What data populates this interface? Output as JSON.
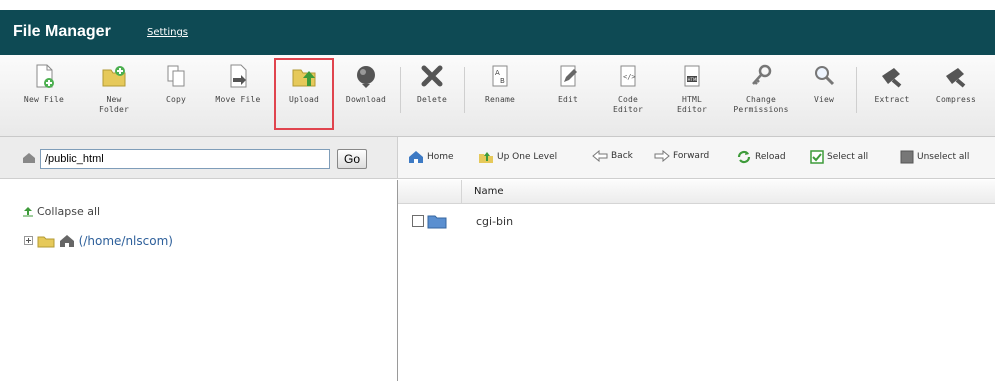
{
  "header": {
    "title": "File Manager",
    "settings_link": "Settings"
  },
  "toolbar": {
    "tools": [
      {
        "id": "new-file",
        "label": "New File",
        "icon": "new-file-icon"
      },
      {
        "id": "new-folder",
        "label": "New\nFolder",
        "icon": "new-folder-icon"
      },
      {
        "id": "copy",
        "label": "Copy",
        "icon": "copy-icon"
      },
      {
        "id": "move-file",
        "label": "Move File",
        "icon": "move-file-icon"
      },
      {
        "id": "upload",
        "label": "Upload",
        "icon": "upload-icon",
        "highlighted": true
      },
      {
        "id": "download",
        "label": "Download",
        "icon": "download-icon"
      },
      {
        "id": "delete",
        "label": "Delete",
        "icon": "delete-icon"
      },
      {
        "id": "rename",
        "label": "Rename",
        "icon": "rename-icon"
      },
      {
        "id": "edit",
        "label": "Edit",
        "icon": "edit-icon"
      },
      {
        "id": "code-editor",
        "label": "Code\nEditor",
        "icon": "code-editor-icon"
      },
      {
        "id": "html-editor",
        "label": "HTML\nEditor",
        "icon": "html-editor-icon"
      },
      {
        "id": "change-permissions",
        "label": "Change\nPermissions",
        "icon": "key-icon"
      },
      {
        "id": "view",
        "label": "View",
        "icon": "magnifier-icon"
      },
      {
        "id": "extract",
        "label": "Extract",
        "icon": "extract-icon"
      },
      {
        "id": "compress",
        "label": "Compress",
        "icon": "compress-icon"
      }
    ]
  },
  "path": {
    "value": "/public_html",
    "go_label": "Go"
  },
  "nav": {
    "home": "Home",
    "up_one_level": "Up One Level",
    "back": "Back",
    "forward": "Forward",
    "reload": "Reload",
    "select_all": "Select all",
    "unselect_all": "Unselect all"
  },
  "tree": {
    "collapse_all": "Collapse all",
    "root": "(/home/nlscom)"
  },
  "files": {
    "columns": [
      "Name"
    ],
    "rows": [
      {
        "name": "cgi-bin",
        "type": "folder"
      }
    ]
  },
  "colors": {
    "header_bg": "#0e4a54",
    "highlight": "#e0444e",
    "link": "#2d5f9a"
  }
}
